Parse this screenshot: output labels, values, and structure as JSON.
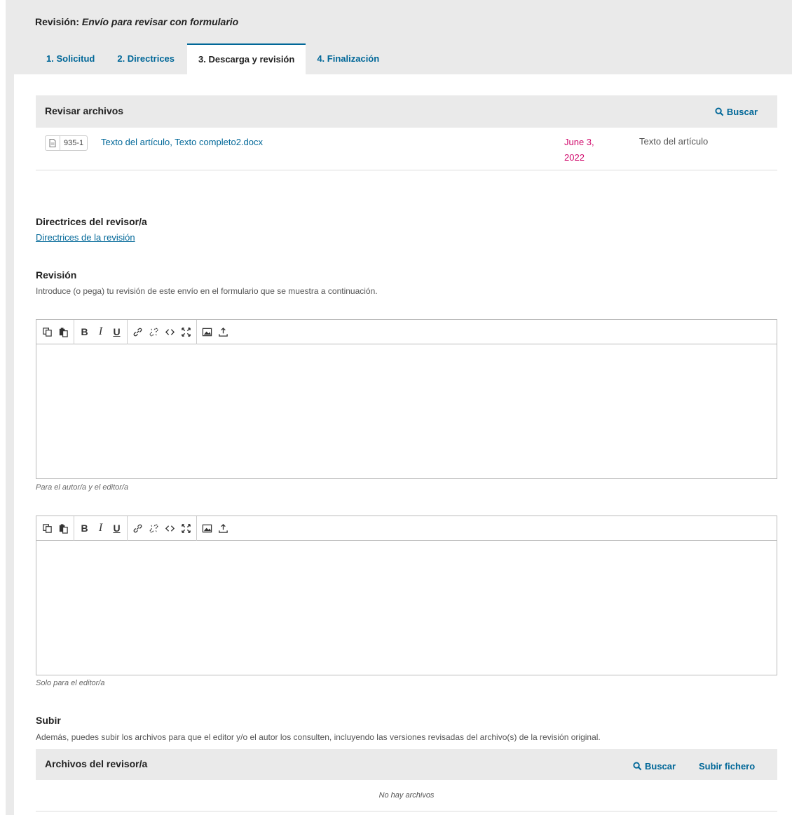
{
  "header": {
    "title_prefix": "Revisión:",
    "title_italic": "Envío para revisar con formulario",
    "tabs": [
      {
        "label": "1. Solicitud"
      },
      {
        "label": "2. Directrices"
      },
      {
        "label": "3. Descarga y revisión"
      },
      {
        "label": "4. Finalización"
      }
    ],
    "active_tab": "3. Descarga y revisión"
  },
  "review_files": {
    "title": "Revisar archivos",
    "search_label": "Buscar",
    "rows": [
      {
        "id": "935-1",
        "name": "Texto del artículo, Texto completo2.docx",
        "date_line1": "June 3,",
        "date_line2": "2022",
        "type": "Texto del artículo"
      }
    ]
  },
  "guidelines": {
    "heading": "Directrices del revisor/a",
    "link": "Directrices de la revisión"
  },
  "review": {
    "heading": "Revisión",
    "description": "Introduce (o pega) tu revisión de este envío en el formulario que se muestra a continuación.",
    "editor1_caption": "Para el autor/a y el editor/a",
    "editor2_caption": "Solo para el editor/a",
    "toolbar": {
      "bold": "B",
      "italic": "I",
      "underline": "U"
    }
  },
  "upload": {
    "heading": "Subir",
    "description": "Además, puedes subir los archivos para que el editor y/o el autor los consulten, incluyendo las versiones revisadas del archivo(s) de la revisión original.",
    "grid_title": "Archivos del revisor/a",
    "search_label": "Buscar",
    "upload_label": "Subir fichero",
    "empty": "No hay archivos"
  },
  "colors": {
    "link": "#006798",
    "date": "#d00a6c",
    "header_bg": "#eaeaea"
  }
}
